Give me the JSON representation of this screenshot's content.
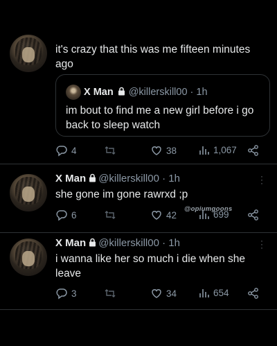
{
  "tweets": [
    {
      "text": "it's crazy that this was me fifteen minutes ago",
      "quote": {
        "name": "X Man",
        "handle": "@killerskill00",
        "time": "· 1h",
        "text": "im bout to find me a new girl before i go back to sleep watch"
      },
      "replies": "4",
      "retweets": "",
      "likes": "38",
      "views": "1,067"
    },
    {
      "name": "X Man",
      "handle": "@killerskill00",
      "time": "· 1h",
      "text": "she gone im gone rawrxd ;p",
      "replies": "6",
      "retweets": "",
      "likes": "42",
      "views": "699"
    },
    {
      "name": "X Man",
      "handle": "@killerskill00",
      "time": "· 1h",
      "text": "i wanna like her so much i die when she leave",
      "replies": "3",
      "retweets": "",
      "likes": "34",
      "views": "654"
    }
  ],
  "watermark": "@opiumgoons",
  "icons": {
    "lock": "lock-icon",
    "reply": "reply-icon",
    "retweet": "retweet-icon",
    "like": "heart-icon",
    "views": "views-icon",
    "share": "share-icon",
    "more": "more-icon"
  },
  "colors": {
    "background": "#000000",
    "text": "#e7e9ea",
    "muted": "#8b98a5",
    "border": "#2f3336"
  }
}
